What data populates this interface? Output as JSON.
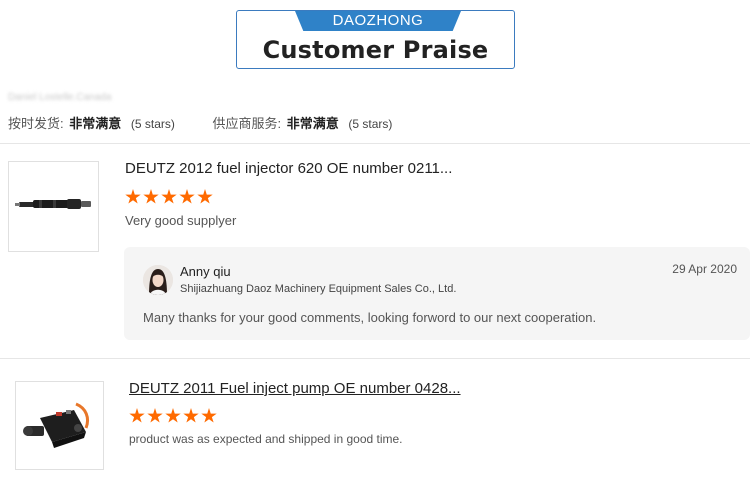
{
  "banner": {
    "tab_label": "DAOZHONG",
    "title": "Customer Praise"
  },
  "reviewer": {
    "name": "Daniel Lostelle.Canada"
  },
  "ratings": {
    "delivery_label": "按时发货:",
    "delivery_value": "非常满意",
    "delivery_stars": "(5 stars)",
    "service_label": "供应商服务:",
    "service_value": "非常满意",
    "service_stars": "(5 stars)"
  },
  "reviews": [
    {
      "product_title": "DEUTZ 2012 fuel injector 620 OE number 0211...",
      "rating": 5,
      "text": "Very good supplyer",
      "image": "fuel-injector",
      "reply": {
        "name": "Anny qiu",
        "company": "Shijiazhuang Daoz Machinery Equipment Sales Co., Ltd.",
        "date": "29 Apr 2020",
        "text": "Many thanks for your good comments, looking forword to our next cooperation."
      }
    },
    {
      "product_title": "DEUTZ 2011 Fuel inject pump OE number 0428...",
      "rating": 5,
      "text": "product was as expected and shipped in good time.",
      "image": "fuel-inject-pump"
    }
  ],
  "colors": {
    "accent_blue": "#2f82c8",
    "star_orange": "#ff6a00",
    "reply_bg": "#f5f5f5"
  }
}
